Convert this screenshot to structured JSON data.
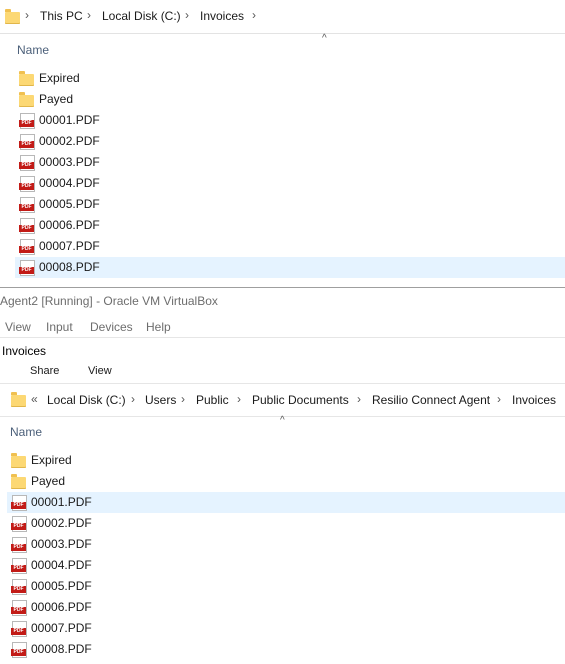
{
  "top_explorer": {
    "breadcrumbs": [
      "This PC",
      "Local Disk (C:)",
      "Invoices"
    ],
    "column_header": "Name",
    "folders": [
      "Expired",
      "Payed"
    ],
    "files": [
      "00001.PDF",
      "00002.PDF",
      "00003.PDF",
      "00004.PDF",
      "00005.PDF",
      "00006.PDF",
      "00007.PDF",
      "00008.PDF"
    ],
    "selected_file_index": 7
  },
  "vbox": {
    "title": "Agent2 [Running] - Oracle VM VirtualBox",
    "menu": [
      "View",
      "Input",
      "Devices",
      "Help"
    ],
    "window_title": "Invoices",
    "ribbon_tabs": [
      "Share",
      "View"
    ],
    "overflow_chevron": "«",
    "breadcrumbs": [
      "Local Disk (C:)",
      "Users",
      "Public",
      "Public Documents",
      "Resilio Connect Agent",
      "Invoices"
    ],
    "column_header": "Name",
    "folders": [
      "Expired",
      "Payed"
    ],
    "files": [
      "00001.PDF",
      "00002.PDF",
      "00003.PDF",
      "00004.PDF",
      "00005.PDF",
      "00006.PDF",
      "00007.PDF",
      "00008.PDF"
    ],
    "selected_file_index": 0
  },
  "colors": {
    "selection": "#e5f3ff",
    "folder": "#fcd874",
    "pdf_red": "#c21b17",
    "header_text": "#4c607a"
  },
  "icons": [
    "folder-icon",
    "pdf-file-icon",
    "chevron-right-icon",
    "sort-up-icon"
  ]
}
